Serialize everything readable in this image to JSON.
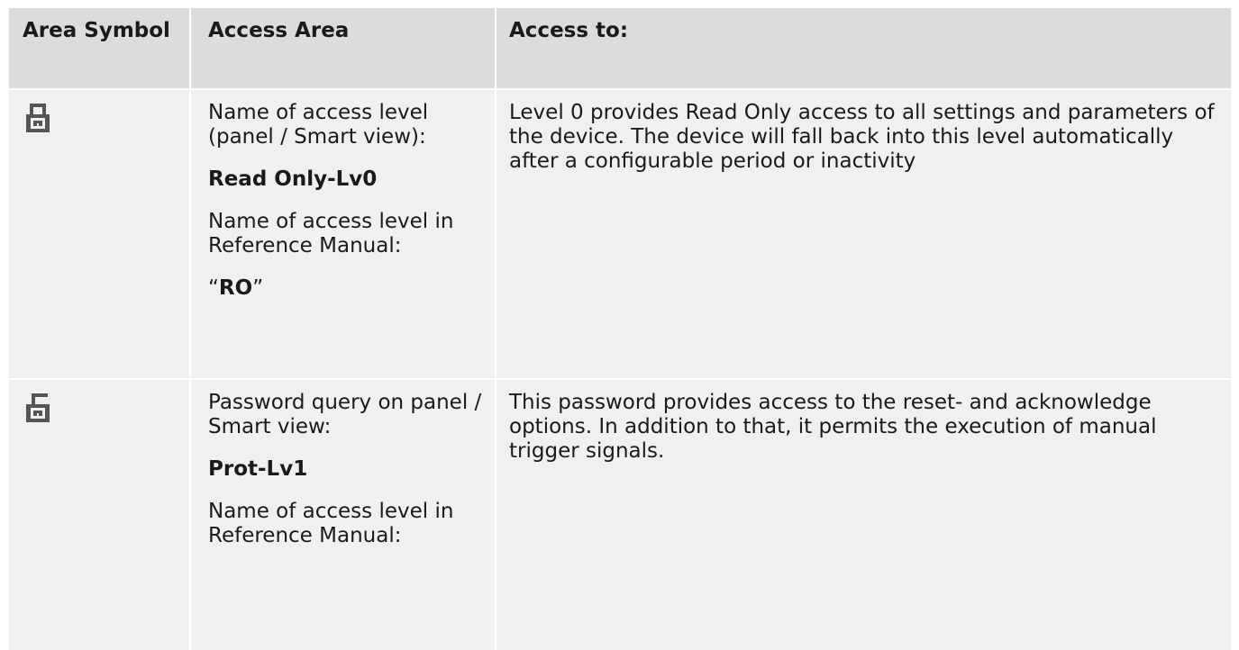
{
  "header": {
    "col1": "Area Symbol",
    "col2": "Access Area",
    "col3": "Access to:"
  },
  "rows": [
    {
      "icon": "lock-closed-icon",
      "name_label": "Name of access level (panel / Smart view):",
      "name_value": "Read Only-Lv0",
      "manual_label": "Name of access level in Reference Manual:",
      "manual_value": "RO",
      "quote_open": "“",
      "quote_close": "”",
      "access": "Level 0 provides Read Only access to all settings and parameters of the device. The device will fall back into this level automatically after a configurable period or inactivity"
    },
    {
      "icon": "lock-open-icon",
      "name_label": "Password query on panel / Smart view:",
      "name_value": "Prot-Lv1",
      "manual_label": "Name of access level in Reference Manual:",
      "access": "This password provides access to the reset- and acknowledge options. In addition to that, it permits the execution of manual trigger signals."
    }
  ],
  "colors": {
    "header_bg": "#dcdcdc",
    "cell_bg": "#f0f0f0",
    "icon": "#555555"
  }
}
